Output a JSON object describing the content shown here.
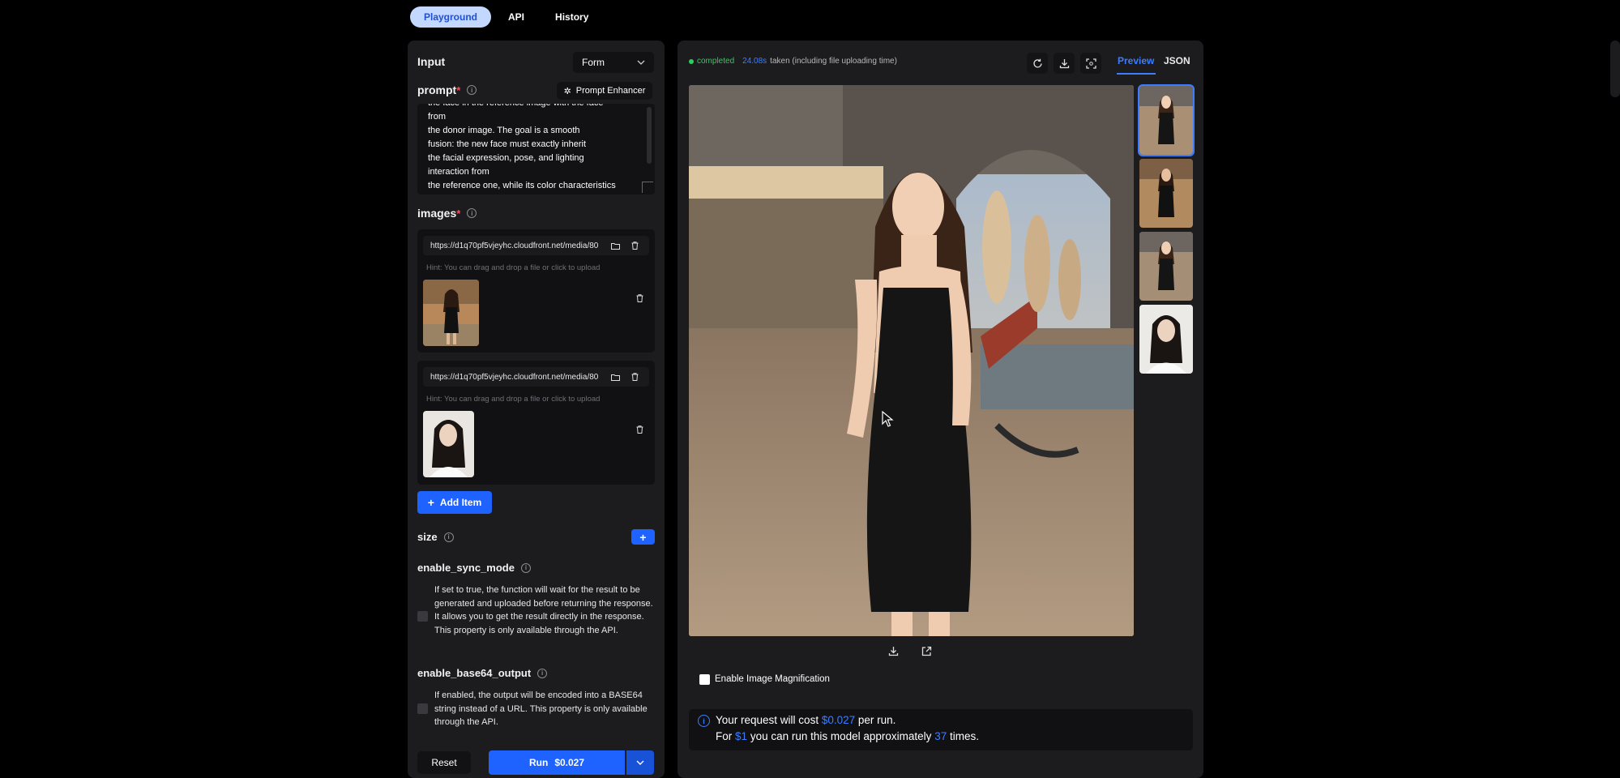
{
  "nav": {
    "tabs": [
      {
        "label": "Playground",
        "active": true
      },
      {
        "label": "API",
        "active": false
      },
      {
        "label": "History",
        "active": false
      }
    ]
  },
  "input_panel": {
    "title": "Input",
    "mode_select": "Form",
    "prompt": {
      "label": "prompt",
      "required_mark": "*",
      "enhancer_label": "Prompt Enhancer",
      "visible_lines": [
        "the face in the reference image with the face",
        "from",
        "the donor image. The goal is a smooth",
        "fusion: the new face must exactly inherit",
        "the facial expression, pose, and lighting",
        "interaction from",
        "the reference one, while its color characteristics"
      ]
    },
    "images": {
      "label": "images",
      "required_mark": "*",
      "items": [
        {
          "url": "https://d1q70pf5vjeyhc.cloudfront.net/media/80",
          "hint": "Hint: You can drag and drop a file or click to upload"
        },
        {
          "url": "https://d1q70pf5vjeyhc.cloudfront.net/media/80",
          "hint": "Hint: You can drag and drop a file or click to upload"
        }
      ],
      "add_label": "Add Item"
    },
    "size": {
      "label": "size",
      "add_icon": "plus-icon"
    },
    "enable_sync_mode": {
      "label": "enable_sync_mode",
      "checked": false,
      "description": "If set to true, the function will wait for the result to be generated and uploaded before returning the response. It allows you to get the result directly in the response. This property is only available through the API."
    },
    "enable_base64_output": {
      "label": "enable_base64_output",
      "checked": false,
      "description": "If enabled, the output will be encoded into a BASE64 string instead of a URL. This property is only available through the API."
    },
    "reset_label": "Reset",
    "run_label": "Run",
    "run_price": "$0.027"
  },
  "output_panel": {
    "status": "completed",
    "time": "24.08s",
    "time_suffix": "taken (including file uploading time)",
    "tabs": [
      {
        "label": "Preview",
        "active": true
      },
      {
        "label": "JSON",
        "active": false
      }
    ],
    "icons": [
      "refresh-icon",
      "download-icon",
      "fullscreen-icon"
    ],
    "magnification_label": "Enable Image Magnification",
    "magnification_checked": false,
    "cost": {
      "line1_a": "Your request will cost",
      "price": "$0.027",
      "line1_b": "per run.",
      "line2_a": "For",
      "budget": "$1",
      "line2_b": "you can run this model approximately",
      "times": "37",
      "line2_c": "times."
    }
  },
  "colors": {
    "accent": "#1e63ff",
    "link": "#3c7dff",
    "success": "#2ccf5c",
    "panel": "#1c1c1e",
    "background": "#000000"
  }
}
